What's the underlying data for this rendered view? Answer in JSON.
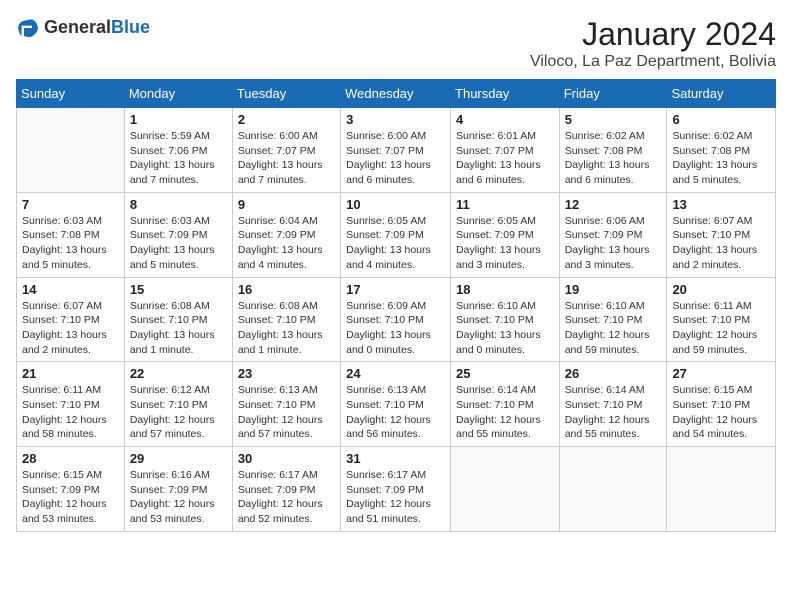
{
  "header": {
    "logo_general": "General",
    "logo_blue": "Blue",
    "month_title": "January 2024",
    "location": "Viloco, La Paz Department, Bolivia"
  },
  "calendar": {
    "days_of_week": [
      "Sunday",
      "Monday",
      "Tuesday",
      "Wednesday",
      "Thursday",
      "Friday",
      "Saturday"
    ],
    "weeks": [
      [
        {
          "num": "",
          "empty": true
        },
        {
          "num": "1",
          "sunrise": "Sunrise: 5:59 AM",
          "sunset": "Sunset: 7:06 PM",
          "daylight": "Daylight: 13 hours and 7 minutes."
        },
        {
          "num": "2",
          "sunrise": "Sunrise: 6:00 AM",
          "sunset": "Sunset: 7:07 PM",
          "daylight": "Daylight: 13 hours and 7 minutes."
        },
        {
          "num": "3",
          "sunrise": "Sunrise: 6:00 AM",
          "sunset": "Sunset: 7:07 PM",
          "daylight": "Daylight: 13 hours and 6 minutes."
        },
        {
          "num": "4",
          "sunrise": "Sunrise: 6:01 AM",
          "sunset": "Sunset: 7:07 PM",
          "daylight": "Daylight: 13 hours and 6 minutes."
        },
        {
          "num": "5",
          "sunrise": "Sunrise: 6:02 AM",
          "sunset": "Sunset: 7:08 PM",
          "daylight": "Daylight: 13 hours and 6 minutes."
        },
        {
          "num": "6",
          "sunrise": "Sunrise: 6:02 AM",
          "sunset": "Sunset: 7:08 PM",
          "daylight": "Daylight: 13 hours and 5 minutes."
        }
      ],
      [
        {
          "num": "7",
          "sunrise": "Sunrise: 6:03 AM",
          "sunset": "Sunset: 7:08 PM",
          "daylight": "Daylight: 13 hours and 5 minutes."
        },
        {
          "num": "8",
          "sunrise": "Sunrise: 6:03 AM",
          "sunset": "Sunset: 7:09 PM",
          "daylight": "Daylight: 13 hours and 5 minutes."
        },
        {
          "num": "9",
          "sunrise": "Sunrise: 6:04 AM",
          "sunset": "Sunset: 7:09 PM",
          "daylight": "Daylight: 13 hours and 4 minutes."
        },
        {
          "num": "10",
          "sunrise": "Sunrise: 6:05 AM",
          "sunset": "Sunset: 7:09 PM",
          "daylight": "Daylight: 13 hours and 4 minutes."
        },
        {
          "num": "11",
          "sunrise": "Sunrise: 6:05 AM",
          "sunset": "Sunset: 7:09 PM",
          "daylight": "Daylight: 13 hours and 3 minutes."
        },
        {
          "num": "12",
          "sunrise": "Sunrise: 6:06 AM",
          "sunset": "Sunset: 7:09 PM",
          "daylight": "Daylight: 13 hours and 3 minutes."
        },
        {
          "num": "13",
          "sunrise": "Sunrise: 6:07 AM",
          "sunset": "Sunset: 7:10 PM",
          "daylight": "Daylight: 13 hours and 2 minutes."
        }
      ],
      [
        {
          "num": "14",
          "sunrise": "Sunrise: 6:07 AM",
          "sunset": "Sunset: 7:10 PM",
          "daylight": "Daylight: 13 hours and 2 minutes."
        },
        {
          "num": "15",
          "sunrise": "Sunrise: 6:08 AM",
          "sunset": "Sunset: 7:10 PM",
          "daylight": "Daylight: 13 hours and 1 minute."
        },
        {
          "num": "16",
          "sunrise": "Sunrise: 6:08 AM",
          "sunset": "Sunset: 7:10 PM",
          "daylight": "Daylight: 13 hours and 1 minute."
        },
        {
          "num": "17",
          "sunrise": "Sunrise: 6:09 AM",
          "sunset": "Sunset: 7:10 PM",
          "daylight": "Daylight: 13 hours and 0 minutes."
        },
        {
          "num": "18",
          "sunrise": "Sunrise: 6:10 AM",
          "sunset": "Sunset: 7:10 PM",
          "daylight": "Daylight: 13 hours and 0 minutes."
        },
        {
          "num": "19",
          "sunrise": "Sunrise: 6:10 AM",
          "sunset": "Sunset: 7:10 PM",
          "daylight": "Daylight: 12 hours and 59 minutes."
        },
        {
          "num": "20",
          "sunrise": "Sunrise: 6:11 AM",
          "sunset": "Sunset: 7:10 PM",
          "daylight": "Daylight: 12 hours and 59 minutes."
        }
      ],
      [
        {
          "num": "21",
          "sunrise": "Sunrise: 6:11 AM",
          "sunset": "Sunset: 7:10 PM",
          "daylight": "Daylight: 12 hours and 58 minutes."
        },
        {
          "num": "22",
          "sunrise": "Sunrise: 6:12 AM",
          "sunset": "Sunset: 7:10 PM",
          "daylight": "Daylight: 12 hours and 57 minutes."
        },
        {
          "num": "23",
          "sunrise": "Sunrise: 6:13 AM",
          "sunset": "Sunset: 7:10 PM",
          "daylight": "Daylight: 12 hours and 57 minutes."
        },
        {
          "num": "24",
          "sunrise": "Sunrise: 6:13 AM",
          "sunset": "Sunset: 7:10 PM",
          "daylight": "Daylight: 12 hours and 56 minutes."
        },
        {
          "num": "25",
          "sunrise": "Sunrise: 6:14 AM",
          "sunset": "Sunset: 7:10 PM",
          "daylight": "Daylight: 12 hours and 55 minutes."
        },
        {
          "num": "26",
          "sunrise": "Sunrise: 6:14 AM",
          "sunset": "Sunset: 7:10 PM",
          "daylight": "Daylight: 12 hours and 55 minutes."
        },
        {
          "num": "27",
          "sunrise": "Sunrise: 6:15 AM",
          "sunset": "Sunset: 7:10 PM",
          "daylight": "Daylight: 12 hours and 54 minutes."
        }
      ],
      [
        {
          "num": "28",
          "sunrise": "Sunrise: 6:15 AM",
          "sunset": "Sunset: 7:09 PM",
          "daylight": "Daylight: 12 hours and 53 minutes."
        },
        {
          "num": "29",
          "sunrise": "Sunrise: 6:16 AM",
          "sunset": "Sunset: 7:09 PM",
          "daylight": "Daylight: 12 hours and 53 minutes."
        },
        {
          "num": "30",
          "sunrise": "Sunrise: 6:17 AM",
          "sunset": "Sunset: 7:09 PM",
          "daylight": "Daylight: 12 hours and 52 minutes."
        },
        {
          "num": "31",
          "sunrise": "Sunrise: 6:17 AM",
          "sunset": "Sunset: 7:09 PM",
          "daylight": "Daylight: 12 hours and 51 minutes."
        },
        {
          "num": "",
          "empty": true
        },
        {
          "num": "",
          "empty": true
        },
        {
          "num": "",
          "empty": true
        }
      ]
    ]
  }
}
